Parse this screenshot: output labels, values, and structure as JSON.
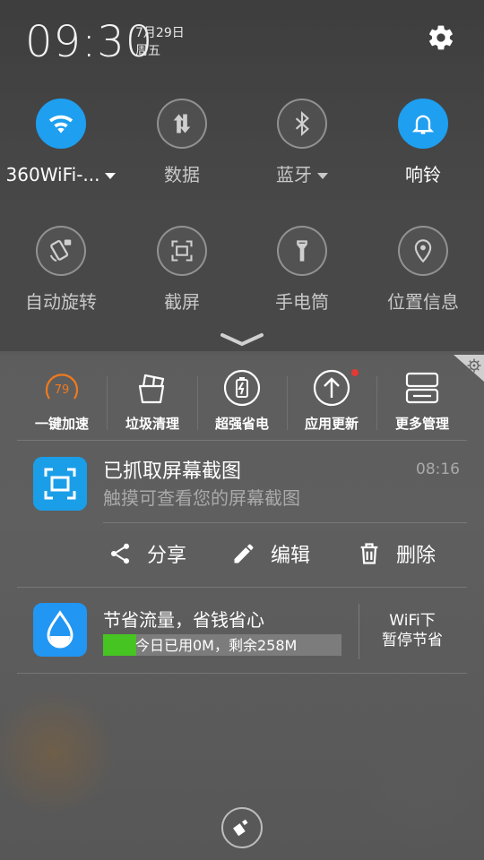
{
  "status": {
    "time": "09:30",
    "date": "7月29日",
    "weekday": "周五",
    "settings_icon": "gear-icon"
  },
  "quick_toggles": [
    {
      "label": "360WiFi-...",
      "icon": "wifi-icon",
      "active": true,
      "dropdown": true
    },
    {
      "label": "数据",
      "icon": "mobile-data-icon",
      "active": false
    },
    {
      "label": "蓝牙",
      "icon": "bluetooth-icon",
      "active": false,
      "dropdown": true
    },
    {
      "label": "响铃",
      "icon": "bell-icon",
      "active": true
    },
    {
      "label": "自动旋转",
      "icon": "auto-rotate-icon",
      "active": false
    },
    {
      "label": "截屏",
      "icon": "screenshot-icon",
      "active": false
    },
    {
      "label": "手电筒",
      "icon": "flashlight-icon",
      "active": false
    },
    {
      "label": "位置信息",
      "icon": "location-icon",
      "active": false
    }
  ],
  "toolbar": [
    {
      "label": "一键加速",
      "icon": "speed-gauge-icon",
      "value": "79"
    },
    {
      "label": "垃圾清理",
      "icon": "trash-clean-icon"
    },
    {
      "label": "超强省电",
      "icon": "battery-saver-icon"
    },
    {
      "label": "应用更新",
      "icon": "app-update-icon",
      "badge": true
    },
    {
      "label": "更多管理",
      "icon": "more-manage-icon"
    }
  ],
  "screenshot_notification": {
    "title": "已抓取屏幕截图",
    "text": "触摸可查看您的屏幕截图",
    "time": "08:16",
    "icon": "screenshot-app-icon",
    "actions": [
      {
        "label": "分享",
        "icon": "share-icon"
      },
      {
        "label": "编辑",
        "icon": "pencil-icon"
      },
      {
        "label": "删除",
        "icon": "trash-icon"
      }
    ]
  },
  "data_notification": {
    "title": "节省流量，省钱省心",
    "usage_text": "今日已用0M，剩余258M",
    "usage_fraction": 0.14,
    "pause_line1": "WiFi下",
    "pause_line2": "暂停节省",
    "icon": "water-drop-icon"
  },
  "colors": {
    "accent": "#1e9ff0",
    "progress": "#46c422",
    "badge": "#e53935",
    "speed_ring": "#f07a1e"
  },
  "clear_button_icon": "broom-icon"
}
